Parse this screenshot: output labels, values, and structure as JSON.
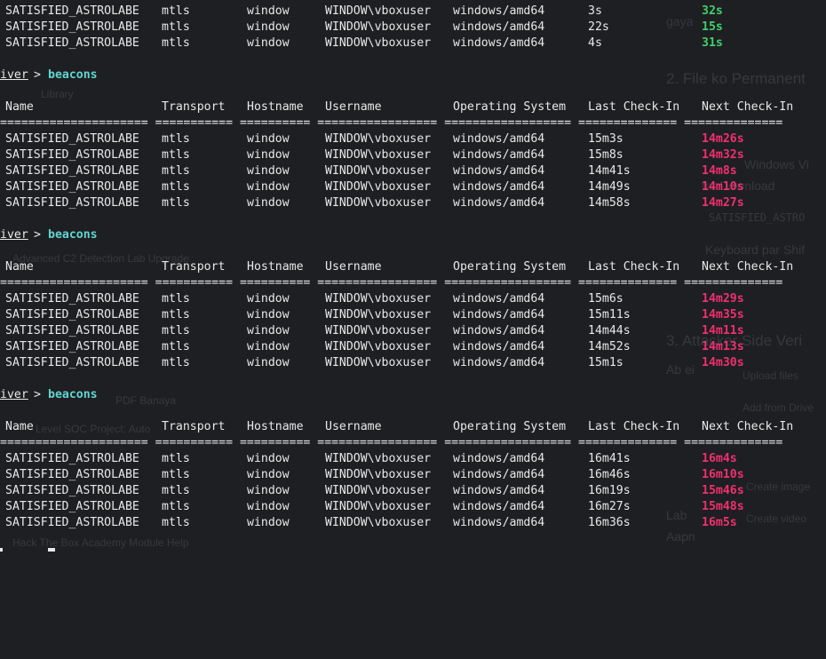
{
  "terminal": {
    "prompt_host": "iver",
    "prompt_symbol": ">",
    "command": "beacons",
    "headers": [
      "Name",
      "Transport",
      "Hostname",
      "Username",
      "Operating System",
      "Last Check-In",
      "Next Check-In"
    ],
    "separator": "===================== =========== ========== ================= ================== ============== ==============",
    "top_rows": [
      {
        "name": "SATISFIED_ASTROLABE",
        "transport": "mtls",
        "hostname": "window",
        "username": "WINDOW\\vboxuser",
        "os": "windows/amd64",
        "last": "3s",
        "next": "32s"
      },
      {
        "name": "SATISFIED_ASTROLABE",
        "transport": "mtls",
        "hostname": "window",
        "username": "WINDOW\\vboxuser",
        "os": "windows/amd64",
        "last": "22s",
        "next": "15s"
      },
      {
        "name": "SATISFIED_ASTROLABE",
        "transport": "mtls",
        "hostname": "window",
        "username": "WINDOW\\vboxuser",
        "os": "windows/amd64",
        "last": "4s",
        "next": "31s"
      }
    ],
    "blocks": [
      {
        "rows": [
          {
            "name": "SATISFIED_ASTROLABE",
            "transport": "mtls",
            "hostname": "window",
            "username": "WINDOW\\vboxuser",
            "os": "windows/amd64",
            "last": "15m3s",
            "next": "14m26s"
          },
          {
            "name": "SATISFIED_ASTROLABE",
            "transport": "mtls",
            "hostname": "window",
            "username": "WINDOW\\vboxuser",
            "os": "windows/amd64",
            "last": "15m8s",
            "next": "14m32s"
          },
          {
            "name": "SATISFIED_ASTROLABE",
            "transport": "mtls",
            "hostname": "window",
            "username": "WINDOW\\vboxuser",
            "os": "windows/amd64",
            "last": "14m41s",
            "next": "14m8s"
          },
          {
            "name": "SATISFIED_ASTROLABE",
            "transport": "mtls",
            "hostname": "window",
            "username": "WINDOW\\vboxuser",
            "os": "windows/amd64",
            "last": "14m49s",
            "next": "14m10s"
          },
          {
            "name": "SATISFIED_ASTROLABE",
            "transport": "mtls",
            "hostname": "window",
            "username": "WINDOW\\vboxuser",
            "os": "windows/amd64",
            "last": "14m58s",
            "next": "14m27s"
          }
        ]
      },
      {
        "rows": [
          {
            "name": "SATISFIED_ASTROLABE",
            "transport": "mtls",
            "hostname": "window",
            "username": "WINDOW\\vboxuser",
            "os": "windows/amd64",
            "last": "15m6s",
            "next": "14m29s"
          },
          {
            "name": "SATISFIED_ASTROLABE",
            "transport": "mtls",
            "hostname": "window",
            "username": "WINDOW\\vboxuser",
            "os": "windows/amd64",
            "last": "15m11s",
            "next": "14m35s"
          },
          {
            "name": "SATISFIED_ASTROLABE",
            "transport": "mtls",
            "hostname": "window",
            "username": "WINDOW\\vboxuser",
            "os": "windows/amd64",
            "last": "14m44s",
            "next": "14m11s"
          },
          {
            "name": "SATISFIED_ASTROLABE",
            "transport": "mtls",
            "hostname": "window",
            "username": "WINDOW\\vboxuser",
            "os": "windows/amd64",
            "last": "14m52s",
            "next": "14m13s"
          },
          {
            "name": "SATISFIED_ASTROLABE",
            "transport": "mtls",
            "hostname": "window",
            "username": "WINDOW\\vboxuser",
            "os": "windows/amd64",
            "last": "15m1s",
            "next": "14m30s"
          }
        ]
      },
      {
        "rows": [
          {
            "name": "SATISFIED_ASTROLABE",
            "transport": "mtls",
            "hostname": "window",
            "username": "WINDOW\\vboxuser",
            "os": "windows/amd64",
            "last": "16m41s",
            "next": "16m4s"
          },
          {
            "name": "SATISFIED_ASTROLABE",
            "transport": "mtls",
            "hostname": "window",
            "username": "WINDOW\\vboxuser",
            "os": "windows/amd64",
            "last": "16m46s",
            "next": "16m10s"
          },
          {
            "name": "SATISFIED_ASTROLABE",
            "transport": "mtls",
            "hostname": "window",
            "username": "WINDOW\\vboxuser",
            "os": "windows/amd64",
            "last": "16m19s",
            "next": "15m46s"
          },
          {
            "name": "SATISFIED_ASTROLABE",
            "transport": "mtls",
            "hostname": "window",
            "username": "WINDOW\\vboxuser",
            "os": "windows/amd64",
            "last": "16m27s",
            "next": "15m48s"
          },
          {
            "name": "SATISFIED_ASTROLABE",
            "transport": "mtls",
            "hostname": "window",
            "username": "WINDOW\\vboxuser",
            "os": "windows/amd64",
            "last": "16m36s",
            "next": "16m5s"
          }
        ]
      }
    ]
  },
  "background": {
    "headings": [
      "2. File ko Permanent",
      "3. Attacker Side Veri"
    ],
    "sidebar": [
      "Library",
      "Advanced C2 Detection Lab Upgrade",
      "PDF Banaya",
      "Level SOC Project: Auto",
      "Hack The Box Academy Module Help"
    ],
    "menu": [
      "Upload files",
      "Add from Drive",
      "Create image",
      "Create video"
    ],
    "body_fragments": [
      "gaya",
      "Windows Vi",
      "tar Download",
      "Keyboard par Shif",
      "Ab ei",
      "Lab",
      "Aapn"
    ],
    "mono_fragment": "SATISFIED_ASTRO"
  },
  "colors": {
    "background": "#1e1f22",
    "text": "#e8e8e8",
    "command": "#5fd7d3",
    "next_recent": "#3fd06a",
    "next_late": "#f0306e"
  }
}
